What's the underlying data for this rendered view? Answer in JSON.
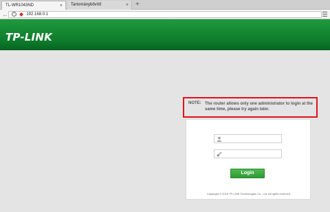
{
  "browser": {
    "tabs": [
      {
        "label": "TL-WR1043ND",
        "active": true
      },
      {
        "label": "Tartománybővítő",
        "active": false
      }
    ],
    "new_tab_symbol": "+",
    "close_symbol": "×",
    "back_symbol": "←",
    "url": "192.168.0.1"
  },
  "header": {
    "logo_text": "TP-LINK",
    "brand_color": "#0e7b2c"
  },
  "note": {
    "label": "NOTE:",
    "text": "The router allows only one administrator to login at the same time, please try again later.",
    "border_color": "#e20f1b"
  },
  "login": {
    "username_icon": "user-icon",
    "password_icon": "key-icon",
    "username_value": "",
    "password_value": "",
    "button_label": "Login",
    "copyright": "Copyright © 2015 TP-LINK Technologies Co., Ltd. All rights reserved."
  }
}
